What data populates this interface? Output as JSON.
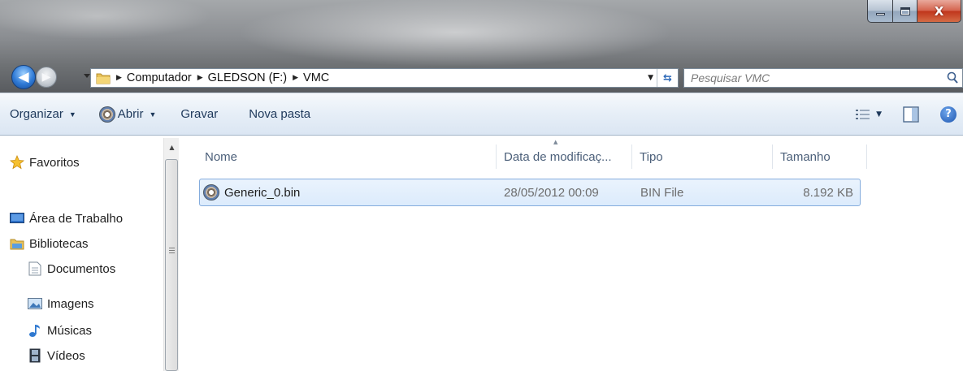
{
  "window": {
    "minimize_icon": "minimize-icon",
    "maximize_icon": "maximize-icon",
    "close_icon": "close-icon",
    "close_glyph": "X"
  },
  "address": {
    "breadcrumbs": [
      "Computador",
      "GLEDSON (F:)",
      "VMC"
    ]
  },
  "search": {
    "placeholder": "Pesquisar VMC"
  },
  "toolbar": {
    "organize_label": "Organizar",
    "open_label": "Abrir",
    "burn_label": "Gravar",
    "new_folder_label": "Nova pasta"
  },
  "nav_pane": {
    "favorites": "Favoritos",
    "desktop": "Área de Trabalho",
    "libraries": "Bibliotecas",
    "documents": "Documentos",
    "images": "Imagens",
    "music": "Músicas",
    "videos": "Vídeos"
  },
  "columns": {
    "name": "Nome",
    "modified": "Data de modificaç...",
    "type": "Tipo",
    "size": "Tamanho"
  },
  "files": [
    {
      "name": "Generic_0.bin",
      "modified": "28/05/2012 00:09",
      "type": "BIN File",
      "size": "8.192 KB",
      "selected": true
    }
  ],
  "colors": {
    "selection_border": "#84acdd",
    "selection_fill": "#dcebfc",
    "toolbar_text": "#1e395b"
  }
}
